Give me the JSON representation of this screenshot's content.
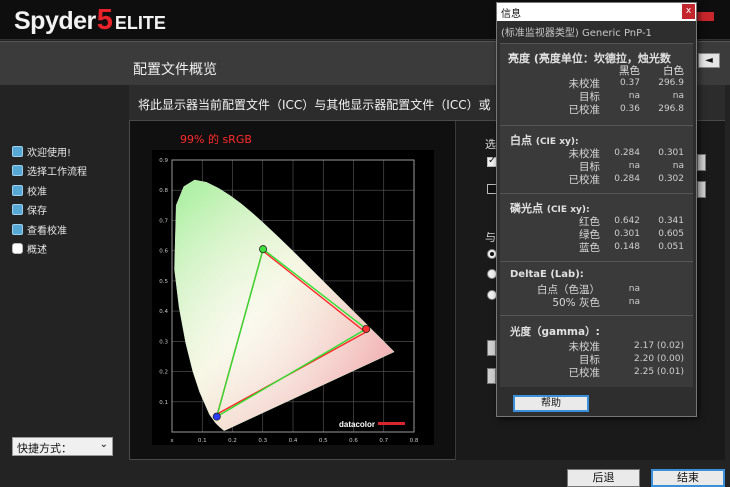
{
  "app": {
    "brand": "Spyder",
    "version_num": "5",
    "edition": "ELITE"
  },
  "page": {
    "title": "配置文件概览"
  },
  "panel": {
    "caption": "将此显示器当前配置文件（ICC）与其他显示器配置文件（ICC）或"
  },
  "sidebar": {
    "items": [
      {
        "label": "欢迎使用!",
        "state": "done"
      },
      {
        "label": "选择工作流程",
        "state": "done"
      },
      {
        "label": "校准",
        "state": "done"
      },
      {
        "label": "保存",
        "state": "done"
      },
      {
        "label": "查看校准",
        "state": "done"
      },
      {
        "label": "概述",
        "state": "current"
      }
    ],
    "shortcut": {
      "label": "快捷方式："
    }
  },
  "gamut": {
    "label": "99% 的 sRGB"
  },
  "right_controls": {
    "options_label": "选",
    "compare_label": "与"
  },
  "buttons": {
    "back": "后退",
    "finish": "结束"
  },
  "info": {
    "title": "信息",
    "close": "x",
    "profile": "(标准监视器类型)  Generic PnP-1",
    "luminance": {
      "title": "亮度 (亮度单位：坎德拉，烛光数",
      "col_black": "黑色",
      "col_white": "白色",
      "rows": [
        {
          "label": "未校准",
          "black": "0.37",
          "white": "296.9"
        },
        {
          "label": "目标",
          "black": "na",
          "white": "na"
        },
        {
          "label": "已校准",
          "black": "0.36",
          "white": "296.8"
        }
      ]
    },
    "white_point": {
      "title": "白点",
      "unit": "(CIE xy):",
      "rows": [
        {
          "label": "未校准",
          "x": "0.284",
          "y": "0.301"
        },
        {
          "label": "目标",
          "x": "na",
          "y": "na"
        },
        {
          "label": "已校准",
          "x": "0.284",
          "y": "0.302"
        }
      ]
    },
    "phosphors": {
      "title": "磷光点",
      "unit": "(CIE xy):",
      "rows": [
        {
          "label": "红色",
          "x": "0.642",
          "y": "0.341"
        },
        {
          "label": "绿色",
          "x": "0.301",
          "y": "0.605"
        },
        {
          "label": "蓝色",
          "x": "0.148",
          "y": "0.051"
        }
      ]
    },
    "delta_e": {
      "title": "DeltaE (Lab):",
      "rows": [
        {
          "label": "白点（色温）",
          "value": "na"
        },
        {
          "label": "50% 灰色",
          "value": "na"
        }
      ]
    },
    "gamma": {
      "title": "光度（gamma）:",
      "rows": [
        {
          "label": "未校准",
          "value": "2.17 (0.02)"
        },
        {
          "label": "目标",
          "value": "2.20 (0.00)"
        },
        {
          "label": "已校准",
          "value": "2.25 (0.01)"
        }
      ]
    },
    "help": "帮助"
  },
  "chart_data": {
    "type": "scatter",
    "title": "",
    "xlabel": "",
    "ylabel": "",
    "xlim": [
      0,
      0.8
    ],
    "ylim": [
      0,
      0.9
    ],
    "x_ticks": [
      "x",
      "0.1",
      "0.2",
      "0.3",
      "0.4",
      "0.5",
      "0.6",
      "0.7",
      "0.8"
    ],
    "y_ticks": [
      "0.1",
      "0.2",
      "0.3",
      "0.4",
      "0.5",
      "0.6",
      "0.7",
      "0.8",
      "0.9"
    ],
    "watermark": "datacolor",
    "grid": true,
    "series": [
      {
        "points": [
          {
            "x": 0.64,
            "y": 0.33
          },
          {
            "x": 0.3,
            "y": 0.6
          },
          {
            "x": 0.15,
            "y": 0.06
          }
        ],
        "color": "#ff2a2a"
      },
      {
        "points": [
          {
            "x": 0.642,
            "y": 0.341
          },
          {
            "x": 0.301,
            "y": 0.605
          },
          {
            "x": 0.148,
            "y": 0.051
          }
        ],
        "color": "#2ee02e"
      }
    ]
  },
  "colors": {
    "accent": "#3b8fd8",
    "brand_red": "#e8222b",
    "step_done": "#58a8d6"
  }
}
